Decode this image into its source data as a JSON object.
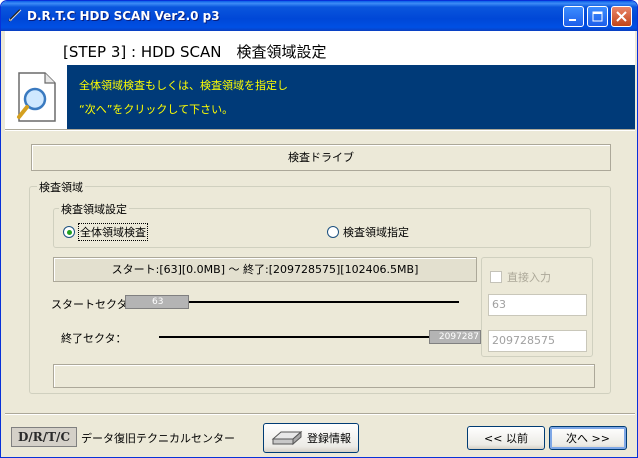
{
  "window": {
    "title": "D.R.T.C HDD SCAN Ver2.0 p3"
  },
  "header": {
    "step_title": "[STEP 3] : HDD SCAN　検査領域設定",
    "instructions": [
      "全体領域検査もしくは、検査領域を指定し",
      "“次へ”をクリックして下さい。"
    ]
  },
  "drive": {
    "label": "検査ドライブ"
  },
  "scan_area": {
    "group_label": "検査領域",
    "setting_label": "検査領域設定",
    "radio_full": {
      "label": "全体領域検査",
      "selected": true
    },
    "radio_range": {
      "label": "検査領域指定",
      "selected": false
    },
    "range_text": "スタート:[63][0.0MB] ～ 終了:[209728575][102406.5MB]",
    "start_label": "スタートセクタ：",
    "end_label": "終了セクタ：",
    "start_thumb": "63",
    "end_thumb": "2097287",
    "direct_input_label": "直接入力",
    "direct_input_checked": false,
    "start_value": "63",
    "end_value": "209728575",
    "status_text": ""
  },
  "footer": {
    "logo": "D/R/T/C",
    "company": "データ復旧テクニカルセンター",
    "register_button": "登録情報",
    "back_button": "<< 以前",
    "next_button": "次へ >>"
  },
  "colors": {
    "banner": "#003A78",
    "banner_text": "#FFFF00",
    "titlebar": "#0050E4"
  }
}
